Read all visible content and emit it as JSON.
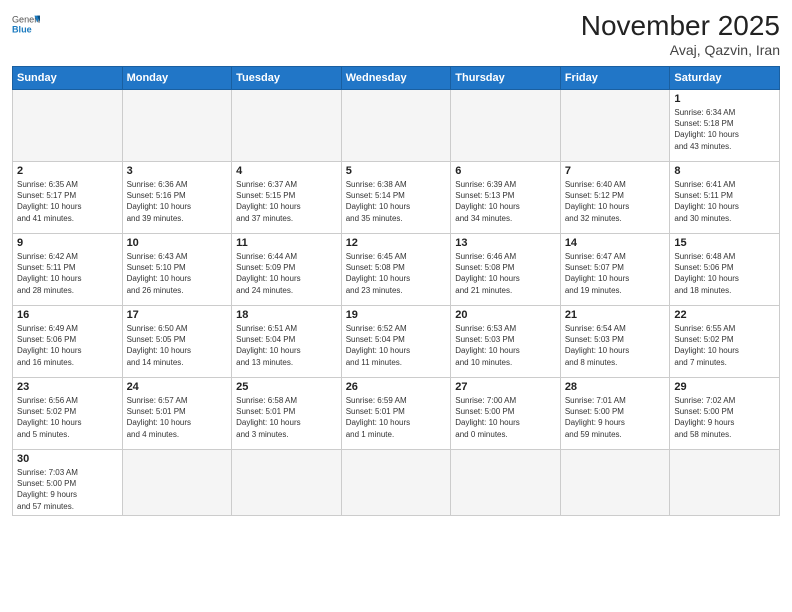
{
  "header": {
    "logo_general": "General",
    "logo_blue": "Blue",
    "month_title": "November 2025",
    "location": "Avaj, Qazvin, Iran"
  },
  "weekdays": [
    "Sunday",
    "Monday",
    "Tuesday",
    "Wednesday",
    "Thursday",
    "Friday",
    "Saturday"
  ],
  "weeks": [
    [
      {
        "day": "",
        "info": ""
      },
      {
        "day": "",
        "info": ""
      },
      {
        "day": "",
        "info": ""
      },
      {
        "day": "",
        "info": ""
      },
      {
        "day": "",
        "info": ""
      },
      {
        "day": "",
        "info": ""
      },
      {
        "day": "1",
        "info": "Sunrise: 6:34 AM\nSunset: 5:18 PM\nDaylight: 10 hours\nand 43 minutes."
      }
    ],
    [
      {
        "day": "2",
        "info": "Sunrise: 6:35 AM\nSunset: 5:17 PM\nDaylight: 10 hours\nand 41 minutes."
      },
      {
        "day": "3",
        "info": "Sunrise: 6:36 AM\nSunset: 5:16 PM\nDaylight: 10 hours\nand 39 minutes."
      },
      {
        "day": "4",
        "info": "Sunrise: 6:37 AM\nSunset: 5:15 PM\nDaylight: 10 hours\nand 37 minutes."
      },
      {
        "day": "5",
        "info": "Sunrise: 6:38 AM\nSunset: 5:14 PM\nDaylight: 10 hours\nand 35 minutes."
      },
      {
        "day": "6",
        "info": "Sunrise: 6:39 AM\nSunset: 5:13 PM\nDaylight: 10 hours\nand 34 minutes."
      },
      {
        "day": "7",
        "info": "Sunrise: 6:40 AM\nSunset: 5:12 PM\nDaylight: 10 hours\nand 32 minutes."
      },
      {
        "day": "8",
        "info": "Sunrise: 6:41 AM\nSunset: 5:11 PM\nDaylight: 10 hours\nand 30 minutes."
      }
    ],
    [
      {
        "day": "9",
        "info": "Sunrise: 6:42 AM\nSunset: 5:11 PM\nDaylight: 10 hours\nand 28 minutes."
      },
      {
        "day": "10",
        "info": "Sunrise: 6:43 AM\nSunset: 5:10 PM\nDaylight: 10 hours\nand 26 minutes."
      },
      {
        "day": "11",
        "info": "Sunrise: 6:44 AM\nSunset: 5:09 PM\nDaylight: 10 hours\nand 24 minutes."
      },
      {
        "day": "12",
        "info": "Sunrise: 6:45 AM\nSunset: 5:08 PM\nDaylight: 10 hours\nand 23 minutes."
      },
      {
        "day": "13",
        "info": "Sunrise: 6:46 AM\nSunset: 5:08 PM\nDaylight: 10 hours\nand 21 minutes."
      },
      {
        "day": "14",
        "info": "Sunrise: 6:47 AM\nSunset: 5:07 PM\nDaylight: 10 hours\nand 19 minutes."
      },
      {
        "day": "15",
        "info": "Sunrise: 6:48 AM\nSunset: 5:06 PM\nDaylight: 10 hours\nand 18 minutes."
      }
    ],
    [
      {
        "day": "16",
        "info": "Sunrise: 6:49 AM\nSunset: 5:06 PM\nDaylight: 10 hours\nand 16 minutes."
      },
      {
        "day": "17",
        "info": "Sunrise: 6:50 AM\nSunset: 5:05 PM\nDaylight: 10 hours\nand 14 minutes."
      },
      {
        "day": "18",
        "info": "Sunrise: 6:51 AM\nSunset: 5:04 PM\nDaylight: 10 hours\nand 13 minutes."
      },
      {
        "day": "19",
        "info": "Sunrise: 6:52 AM\nSunset: 5:04 PM\nDaylight: 10 hours\nand 11 minutes."
      },
      {
        "day": "20",
        "info": "Sunrise: 6:53 AM\nSunset: 5:03 PM\nDaylight: 10 hours\nand 10 minutes."
      },
      {
        "day": "21",
        "info": "Sunrise: 6:54 AM\nSunset: 5:03 PM\nDaylight: 10 hours\nand 8 minutes."
      },
      {
        "day": "22",
        "info": "Sunrise: 6:55 AM\nSunset: 5:02 PM\nDaylight: 10 hours\nand 7 minutes."
      }
    ],
    [
      {
        "day": "23",
        "info": "Sunrise: 6:56 AM\nSunset: 5:02 PM\nDaylight: 10 hours\nand 5 minutes."
      },
      {
        "day": "24",
        "info": "Sunrise: 6:57 AM\nSunset: 5:01 PM\nDaylight: 10 hours\nand 4 minutes."
      },
      {
        "day": "25",
        "info": "Sunrise: 6:58 AM\nSunset: 5:01 PM\nDaylight: 10 hours\nand 3 minutes."
      },
      {
        "day": "26",
        "info": "Sunrise: 6:59 AM\nSunset: 5:01 PM\nDaylight: 10 hours\nand 1 minute."
      },
      {
        "day": "27",
        "info": "Sunrise: 7:00 AM\nSunset: 5:00 PM\nDaylight: 10 hours\nand 0 minutes."
      },
      {
        "day": "28",
        "info": "Sunrise: 7:01 AM\nSunset: 5:00 PM\nDaylight: 9 hours\nand 59 minutes."
      },
      {
        "day": "29",
        "info": "Sunrise: 7:02 AM\nSunset: 5:00 PM\nDaylight: 9 hours\nand 58 minutes."
      }
    ],
    [
      {
        "day": "30",
        "info": "Sunrise: 7:03 AM\nSunset: 5:00 PM\nDaylight: 9 hours\nand 57 minutes."
      },
      {
        "day": "",
        "info": ""
      },
      {
        "day": "",
        "info": ""
      },
      {
        "day": "",
        "info": ""
      },
      {
        "day": "",
        "info": ""
      },
      {
        "day": "",
        "info": ""
      },
      {
        "day": "",
        "info": ""
      }
    ]
  ]
}
